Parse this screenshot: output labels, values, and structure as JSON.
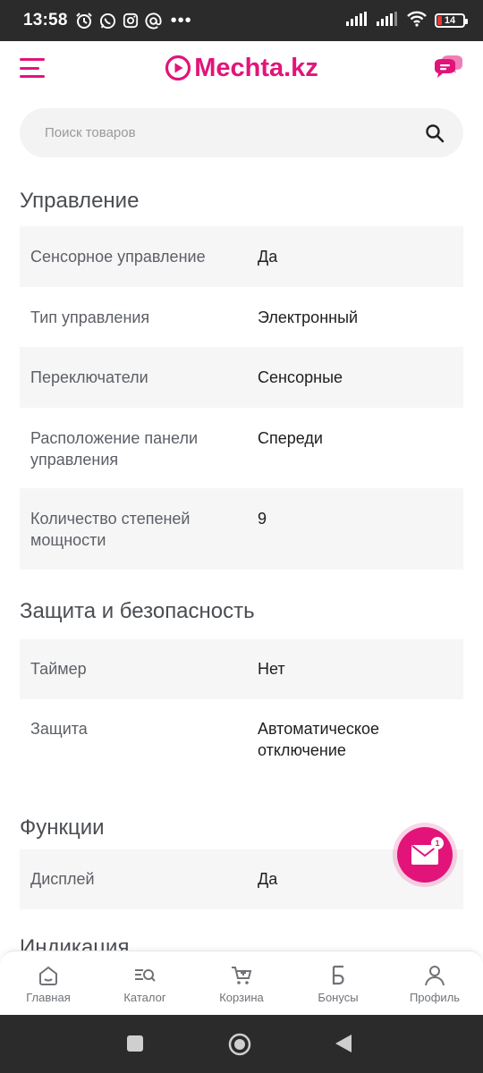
{
  "status_bar": {
    "time": "13:58",
    "dots": "•••",
    "battery": "14"
  },
  "header": {
    "logo_text": "Mechta.kz",
    "brand_color": "#e2147a"
  },
  "search": {
    "placeholder": "Поиск товаров"
  },
  "sections": [
    {
      "title": "Управление",
      "rows": [
        {
          "key": "Сенсорное управление",
          "value": "Да"
        },
        {
          "key": "Тип управления",
          "value": "Электронный"
        },
        {
          "key": "Переключатели",
          "value": "Сенсорные"
        },
        {
          "key": "Расположение панели управления",
          "value": "Спереди"
        },
        {
          "key": "Количество степеней мощности",
          "value": "9"
        }
      ]
    },
    {
      "title": "Защита и безопасность",
      "rows": [
        {
          "key": "Таймер",
          "value": "Нет"
        },
        {
          "key": "Защита",
          "value": "Автоматическое отключение"
        }
      ]
    },
    {
      "title": "Функции",
      "rows": [
        {
          "key": "Дисплей",
          "value": "Да"
        }
      ]
    }
  ],
  "next_section_peek": "Индикация",
  "fab": {
    "badge": "1"
  },
  "bottom_nav": {
    "items": [
      {
        "label": "Главная",
        "icon": "home-icon"
      },
      {
        "label": "Каталог",
        "icon": "catalog-icon"
      },
      {
        "label": "Корзина",
        "icon": "cart-icon"
      },
      {
        "label": "Бонусы",
        "icon": "bonus-icon"
      },
      {
        "label": "Профиль",
        "icon": "profile-icon"
      }
    ]
  }
}
